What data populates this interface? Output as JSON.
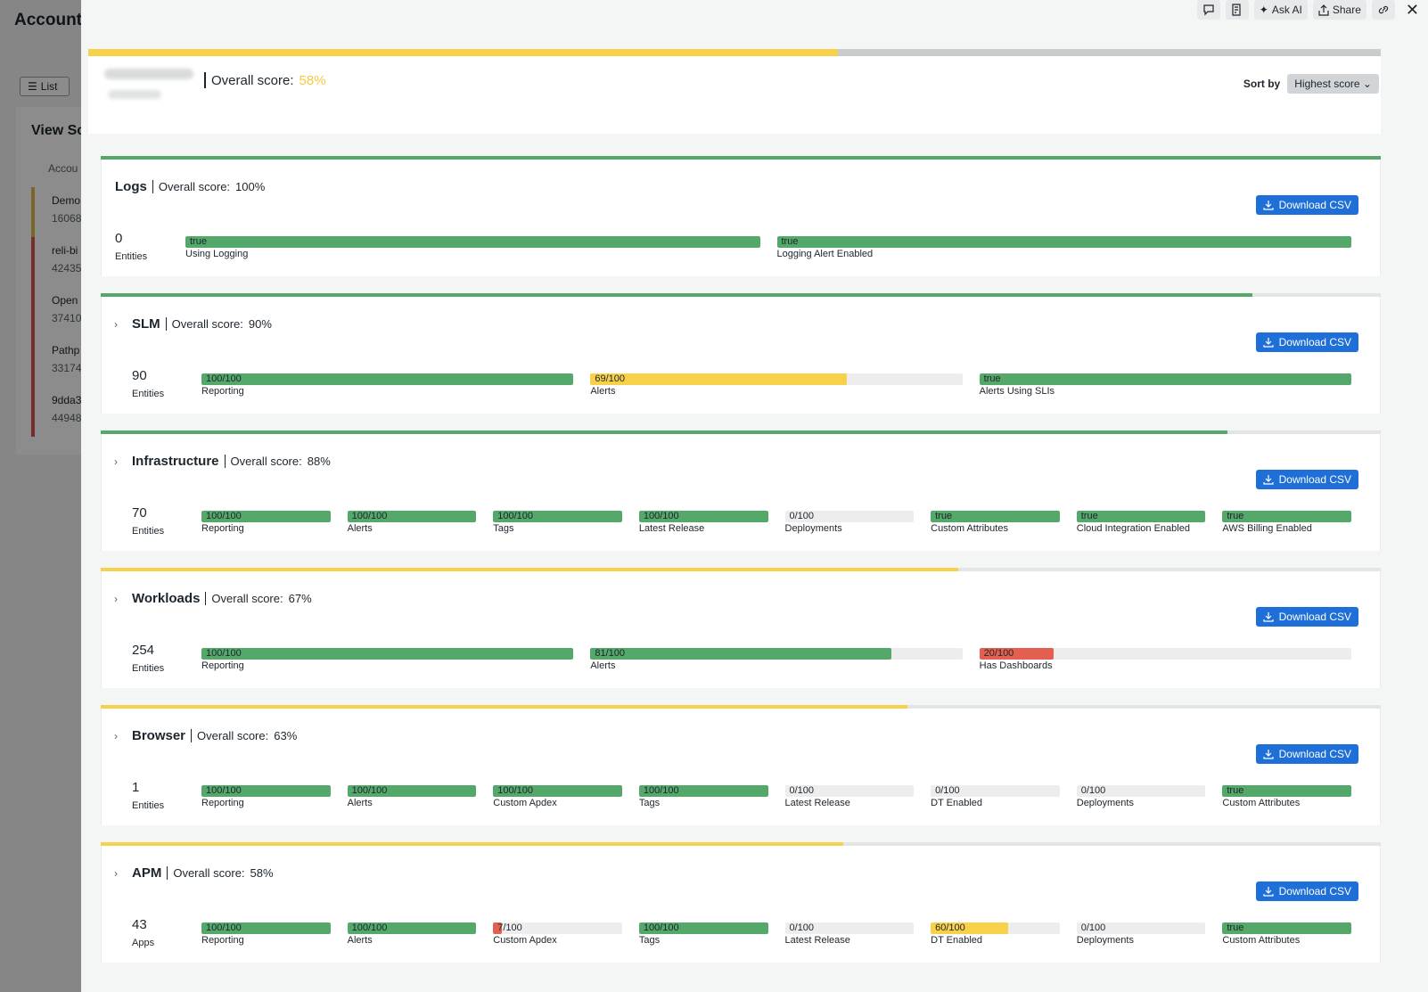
{
  "colors": {
    "green": "#53a86a",
    "yellow": "#f7d14a",
    "red": "#e36050",
    "blue": "#1f6fd8"
  },
  "background": {
    "title": "Account",
    "list_btn": "List",
    "card_title": "View Sc",
    "col_head": "Accou",
    "rows": [
      {
        "name": "Demo",
        "sub": "16068",
        "color": "#e0b64a"
      },
      {
        "name": "reli-bi",
        "sub": "42435",
        "color": "#d9534f"
      },
      {
        "name": "Open",
        "sub": "37410",
        "color": "#d9534f"
      },
      {
        "name": "Pathp",
        "sub": "33174",
        "color": "#d9534f"
      },
      {
        "name": "9dda3",
        "sub": "44948",
        "color": "#d9534f"
      }
    ]
  },
  "toolbar": {
    "comment_icon": "comment-icon",
    "notes_icon": "notes-icon",
    "ask_ai": "Ask AI",
    "share": "Share",
    "link_icon": "link-icon",
    "close": "✕"
  },
  "header": {
    "overall_label": "Overall score:",
    "overall_value": "58%",
    "overall_fraction": 0.58,
    "sort_label": "Sort by",
    "sort_value": "Highest score ⌄"
  },
  "download_label": "Download CSV",
  "panels": [
    {
      "name": "Logs",
      "score": "100%",
      "score_fraction": 1.0,
      "score_color": "green",
      "bar_color": "#53a86a",
      "collapsible": false,
      "count": "0",
      "unit": "Entities",
      "metrics": [
        {
          "value": "true",
          "label": "Using Logging",
          "fraction": 1.0,
          "color": "#53a86a"
        },
        {
          "value": "true",
          "label": "Logging Alert Enabled",
          "fraction": 1.0,
          "color": "#53a86a"
        }
      ]
    },
    {
      "name": "SLM",
      "score": "90%",
      "score_fraction": 0.9,
      "score_color": "green",
      "bar_color": "#53a86a",
      "collapsible": true,
      "count": "90",
      "unit": "Entities",
      "metrics": [
        {
          "value": "100/100",
          "label": "Reporting",
          "fraction": 1.0,
          "color": "#53a86a"
        },
        {
          "value": "69/100",
          "label": "Alerts",
          "fraction": 0.69,
          "color": "#f7d14a"
        },
        {
          "value": "true",
          "label": "Alerts Using SLIs",
          "fraction": 1.0,
          "color": "#53a86a"
        }
      ]
    },
    {
      "name": "Infrastructure",
      "score": "88%",
      "score_fraction": 0.88,
      "score_color": "green",
      "bar_color": "#53a86a",
      "collapsible": true,
      "count": "70",
      "unit": "Entities",
      "metrics": [
        {
          "value": "100/100",
          "label": "Reporting",
          "fraction": 1.0,
          "color": "#53a86a"
        },
        {
          "value": "100/100",
          "label": "Alerts",
          "fraction": 1.0,
          "color": "#53a86a"
        },
        {
          "value": "100/100",
          "label": "Tags",
          "fraction": 1.0,
          "color": "#53a86a"
        },
        {
          "value": "100/100",
          "label": "Latest Release",
          "fraction": 1.0,
          "color": "#53a86a"
        },
        {
          "value": "0/100",
          "label": "Deployments",
          "fraction": 0.0,
          "color": "#e36050"
        },
        {
          "value": "true",
          "label": "Custom Attributes",
          "fraction": 1.0,
          "color": "#53a86a"
        },
        {
          "value": "true",
          "label": "Cloud Integration Enabled",
          "fraction": 1.0,
          "color": "#53a86a"
        },
        {
          "value": "true",
          "label": "AWS Billing Enabled",
          "fraction": 1.0,
          "color": "#53a86a"
        }
      ]
    },
    {
      "name": "Workloads",
      "score": "67%",
      "score_fraction": 0.67,
      "score_color": "yellow",
      "bar_color": "#f7d14a",
      "collapsible": true,
      "count": "254",
      "unit": "Entities",
      "metrics": [
        {
          "value": "100/100",
          "label": "Reporting",
          "fraction": 1.0,
          "color": "#53a86a"
        },
        {
          "value": "81/100",
          "label": "Alerts",
          "fraction": 0.81,
          "color": "#53a86a"
        },
        {
          "value": "20/100",
          "label": "Has Dashboards",
          "fraction": 0.2,
          "color": "#e36050"
        }
      ]
    },
    {
      "name": "Browser",
      "score": "63%",
      "score_fraction": 0.63,
      "score_color": "yellow",
      "bar_color": "#f7d14a",
      "collapsible": true,
      "count": "1",
      "unit": "Entities",
      "metrics": [
        {
          "value": "100/100",
          "label": "Reporting",
          "fraction": 1.0,
          "color": "#53a86a"
        },
        {
          "value": "100/100",
          "label": "Alerts",
          "fraction": 1.0,
          "color": "#53a86a"
        },
        {
          "value": "100/100",
          "label": "Custom Apdex",
          "fraction": 1.0,
          "color": "#53a86a"
        },
        {
          "value": "100/100",
          "label": "Tags",
          "fraction": 1.0,
          "color": "#53a86a"
        },
        {
          "value": "0/100",
          "label": "Latest Release",
          "fraction": 0.0,
          "color": "#e36050"
        },
        {
          "value": "0/100",
          "label": "DT Enabled",
          "fraction": 0.0,
          "color": "#e36050"
        },
        {
          "value": "0/100",
          "label": "Deployments",
          "fraction": 0.0,
          "color": "#e36050"
        },
        {
          "value": "true",
          "label": "Custom Attributes",
          "fraction": 1.0,
          "color": "#53a86a"
        }
      ]
    },
    {
      "name": "APM",
      "score": "58%",
      "score_fraction": 0.58,
      "score_color": "yellow",
      "bar_color": "#f7d14a",
      "collapsible": true,
      "count": "43",
      "unit": "Apps",
      "metrics": [
        {
          "value": "100/100",
          "label": "Reporting",
          "fraction": 1.0,
          "color": "#53a86a"
        },
        {
          "value": "100/100",
          "label": "Alerts",
          "fraction": 1.0,
          "color": "#53a86a"
        },
        {
          "value": "7/100",
          "label": "Custom Apdex",
          "fraction": 0.07,
          "color": "#e36050"
        },
        {
          "value": "100/100",
          "label": "Tags",
          "fraction": 1.0,
          "color": "#53a86a"
        },
        {
          "value": "0/100",
          "label": "Latest Release",
          "fraction": 0.0,
          "color": "#e36050"
        },
        {
          "value": "60/100",
          "label": "DT Enabled",
          "fraction": 0.6,
          "color": "#f7d14a"
        },
        {
          "value": "0/100",
          "label": "Deployments",
          "fraction": 0.0,
          "color": "#e36050"
        },
        {
          "value": "true",
          "label": "Custom Attributes",
          "fraction": 1.0,
          "color": "#53a86a"
        }
      ]
    }
  ]
}
